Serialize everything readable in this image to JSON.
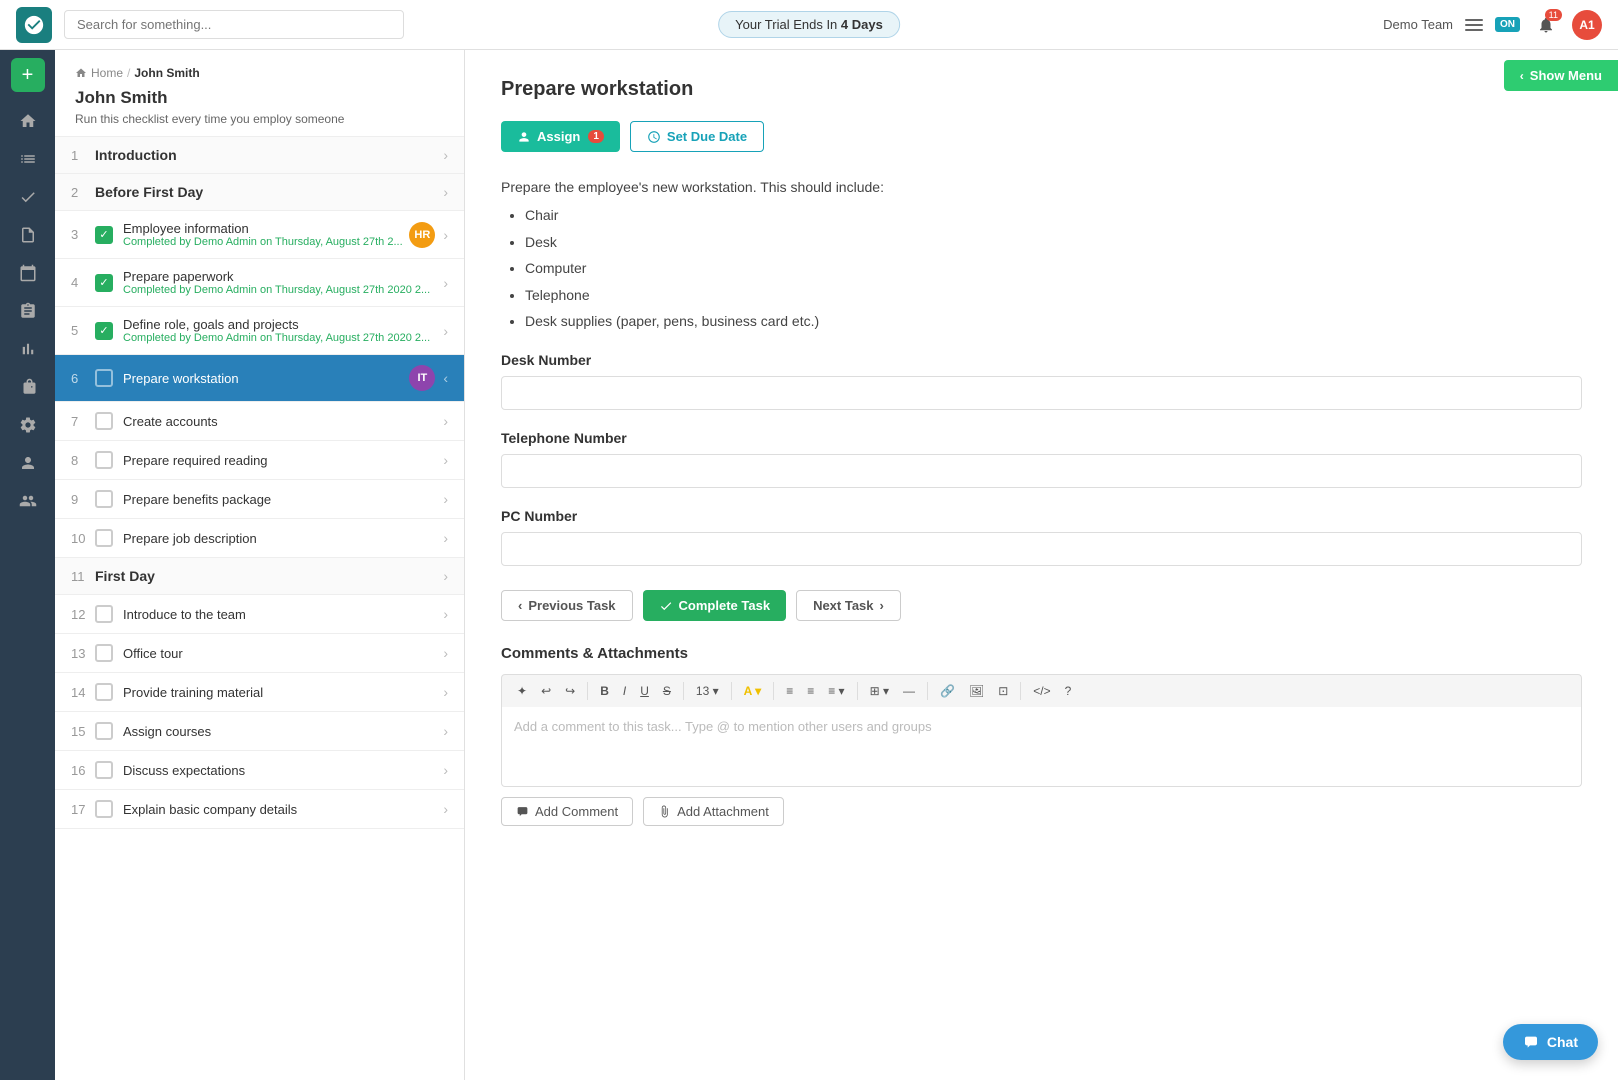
{
  "topbar": {
    "search_placeholder": "Search for something...",
    "trial_text": "Your Trial Ends In",
    "trial_days": "4 Days",
    "team_name": "Demo Team",
    "on_badge": "ON",
    "notif_count": "11",
    "avatar_initials": "A1",
    "show_menu_label": "Show Menu"
  },
  "breadcrumb": {
    "home": "Home",
    "separator": "/",
    "current": "John Smith"
  },
  "checklist": {
    "title": "John Smith",
    "description": "Run this checklist every time you employ someone",
    "sections": [
      {
        "num": "1",
        "label": "Introduction"
      },
      {
        "num": "2",
        "label": "Before First Day"
      }
    ],
    "tasks": [
      {
        "num": "3",
        "label": "Employee information",
        "checked": true,
        "meta": "Completed by Demo Admin on Thursday, August 27th 2...",
        "badge": "HR",
        "badge_class": "badge-hr"
      },
      {
        "num": "4",
        "label": "Prepare paperwork",
        "checked": true,
        "meta": "Completed by Demo Admin on Thursday, August 27th 2020 2...",
        "badge": null
      },
      {
        "num": "5",
        "label": "Define role, goals and projects",
        "checked": true,
        "meta": "Completed by Demo Admin on Thursday, August 27th 2020 2...",
        "badge": null
      },
      {
        "num": "6",
        "label": "Prepare workstation",
        "checked": false,
        "active": true,
        "badge": "IT",
        "badge_class": "badge-it"
      },
      {
        "num": "7",
        "label": "Create accounts",
        "checked": false
      },
      {
        "num": "8",
        "label": "Prepare required reading",
        "checked": false
      },
      {
        "num": "9",
        "label": "Prepare benefits package",
        "checked": false
      },
      {
        "num": "10",
        "label": "Prepare job description",
        "checked": false
      }
    ],
    "section_first_day": {
      "num": "11",
      "label": "First Day"
    },
    "tasks_first_day": [
      {
        "num": "12",
        "label": "Introduce to the team",
        "checked": false
      },
      {
        "num": "13",
        "label": "Office tour",
        "checked": false
      },
      {
        "num": "14",
        "label": "Provide training material",
        "checked": false
      },
      {
        "num": "15",
        "label": "Assign courses",
        "checked": false
      },
      {
        "num": "16",
        "label": "Discuss expectations",
        "checked": false
      },
      {
        "num": "17",
        "label": "Explain basic company details",
        "checked": false
      }
    ]
  },
  "task": {
    "title": "Prepare workstation",
    "assign_label": "Assign",
    "assign_badge": "1",
    "set_due_date_label": "Set Due Date",
    "description": "Prepare the employee's new workstation. This should include:",
    "items": [
      "Chair",
      "Desk",
      "Computer",
      "Telephone",
      "Desk supplies (paper, pens, business card etc.)"
    ],
    "fields": [
      {
        "label": "Desk Number",
        "placeholder": ""
      },
      {
        "label": "Telephone Number",
        "placeholder": ""
      },
      {
        "label": "PC Number",
        "placeholder": ""
      }
    ],
    "prev_task_label": "Previous Task",
    "complete_task_label": "Complete Task",
    "next_task_label": "Next Task"
  },
  "comments": {
    "title": "Comments & Attachments",
    "editor_placeholder": "Add a comment to this task... Type @ to mention other users and groups",
    "add_comment_label": "Add Comment",
    "add_attachment_label": "Add Attachment",
    "toolbar_buttons": [
      "✦",
      "↩",
      "↪",
      "B",
      "I",
      "U",
      "S",
      "13▾",
      "A▾",
      "≡",
      "≡",
      "≡▾",
      "⊞",
      "—",
      "🔗",
      "🖼",
      "⊞",
      "</>",
      "?"
    ]
  },
  "chat": {
    "label": "Chat"
  }
}
